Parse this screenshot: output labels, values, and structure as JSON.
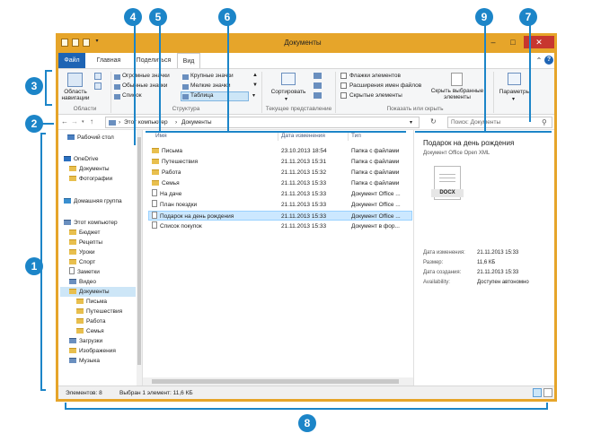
{
  "window": {
    "title": "Документы",
    "qat_icons": [
      "folder-icon",
      "properties-icon",
      "new-folder-icon",
      "dropdown-icon"
    ],
    "controls": {
      "minimize": "–",
      "maximize": "□",
      "close": "✕"
    }
  },
  "tabs": {
    "file": "Файл",
    "home": "Главная",
    "share": "Поделиться",
    "view": "Вид"
  },
  "ribbon": {
    "nav_pane_button": "Область навигации",
    "layout": {
      "large_icons": "Огромные значки",
      "big_icons": "Крупные значки",
      "normal_icons": "Обычные значки",
      "small_icons": "Мелкие значки",
      "list": "Список",
      "table": "Таблица"
    },
    "sort_button": "Сортировать",
    "show_hide": {
      "item_checkboxes": "Флажки элементов",
      "file_extensions": "Расширения имен файлов",
      "hidden_items": "Скрытые элементы",
      "hide_selected": "Скрыть выбранные элементы"
    },
    "options_button": "Параметры",
    "groups": {
      "panes": "Области",
      "layout": "Структура",
      "current_view": "Текущее представление",
      "show_hide": "Показать или скрыть"
    }
  },
  "address": {
    "back": "←",
    "forward": "→",
    "up": "↑",
    "crumbs": [
      "Этот компьютер",
      "Документы"
    ],
    "refresh": "↻",
    "search_placeholder": "Поиск: Документы"
  },
  "nav": {
    "desktop": "Рабочий стол",
    "onedrive": "OneDrive",
    "od_docs": "Документы",
    "od_photos": "Фотографии",
    "homegroup": "Домашняя группа",
    "this_pc": "Этот компьютер",
    "budget": "Бюджет",
    "recipes": "Рецепты",
    "lessons": "Уроки",
    "sport": "Спорт",
    "notes": "Заметки",
    "video": "Видео",
    "documents": "Документы",
    "letters": "Письма",
    "travel": "Путешествия",
    "work": "Работа",
    "family": "Семья",
    "downloads": "Загрузки",
    "images": "Изображения",
    "music": "Музыка"
  },
  "files": {
    "columns": {
      "name": "Имя",
      "date": "Дата изменения",
      "type": "Тип"
    },
    "rows": [
      {
        "name": "Письма",
        "date": "23.10.2013 18:54",
        "type": "Папка с файлами"
      },
      {
        "name": "Путешествия",
        "date": "21.11.2013 15:31",
        "type": "Папка с файлами"
      },
      {
        "name": "Работа",
        "date": "21.11.2013 15:32",
        "type": "Папка с файлами"
      },
      {
        "name": "Семья",
        "date": "21.11.2013 15:33",
        "type": "Папка с файлами"
      },
      {
        "name": "На даче",
        "date": "21.11.2013 15:33",
        "type": "Документ Office ..."
      },
      {
        "name": "План поездки",
        "date": "21.11.2013 15:33",
        "type": "Документ Office ..."
      },
      {
        "name": "Подарок на день рождения",
        "date": "21.11.2013 15:33",
        "type": "Документ Office ..."
      },
      {
        "name": "Список покупок",
        "date": "21.11.2013 15:33",
        "type": "Документ в фор..."
      }
    ]
  },
  "preview": {
    "title": "Подарок на день рождения",
    "subtitle": "Документ Office Open XML",
    "icon_label": "DOCX",
    "props": [
      {
        "k": "Дата изменения:",
        "v": "21.11.2013 15:33"
      },
      {
        "k": "Размер:",
        "v": "11,6 КБ"
      },
      {
        "k": "Дата создания:",
        "v": "21.11.2013 15:33"
      },
      {
        "k": "Availability:",
        "v": "Доступен автономно"
      }
    ]
  },
  "status": {
    "count": "Элементов: 8",
    "selected": "Выбран 1 элемент: 11,6 КБ"
  },
  "callouts": {
    "c1": "1",
    "c2": "2",
    "c3": "3",
    "c4": "4",
    "c5": "5",
    "c6": "6",
    "c7": "7",
    "c8": "8",
    "c9": "9"
  },
  "colors": {
    "frame": "#e6a52a",
    "file_tab": "#1e64b4",
    "callout": "#1c85c8",
    "selection": "#cce8ff",
    "close": "#c7372f"
  }
}
